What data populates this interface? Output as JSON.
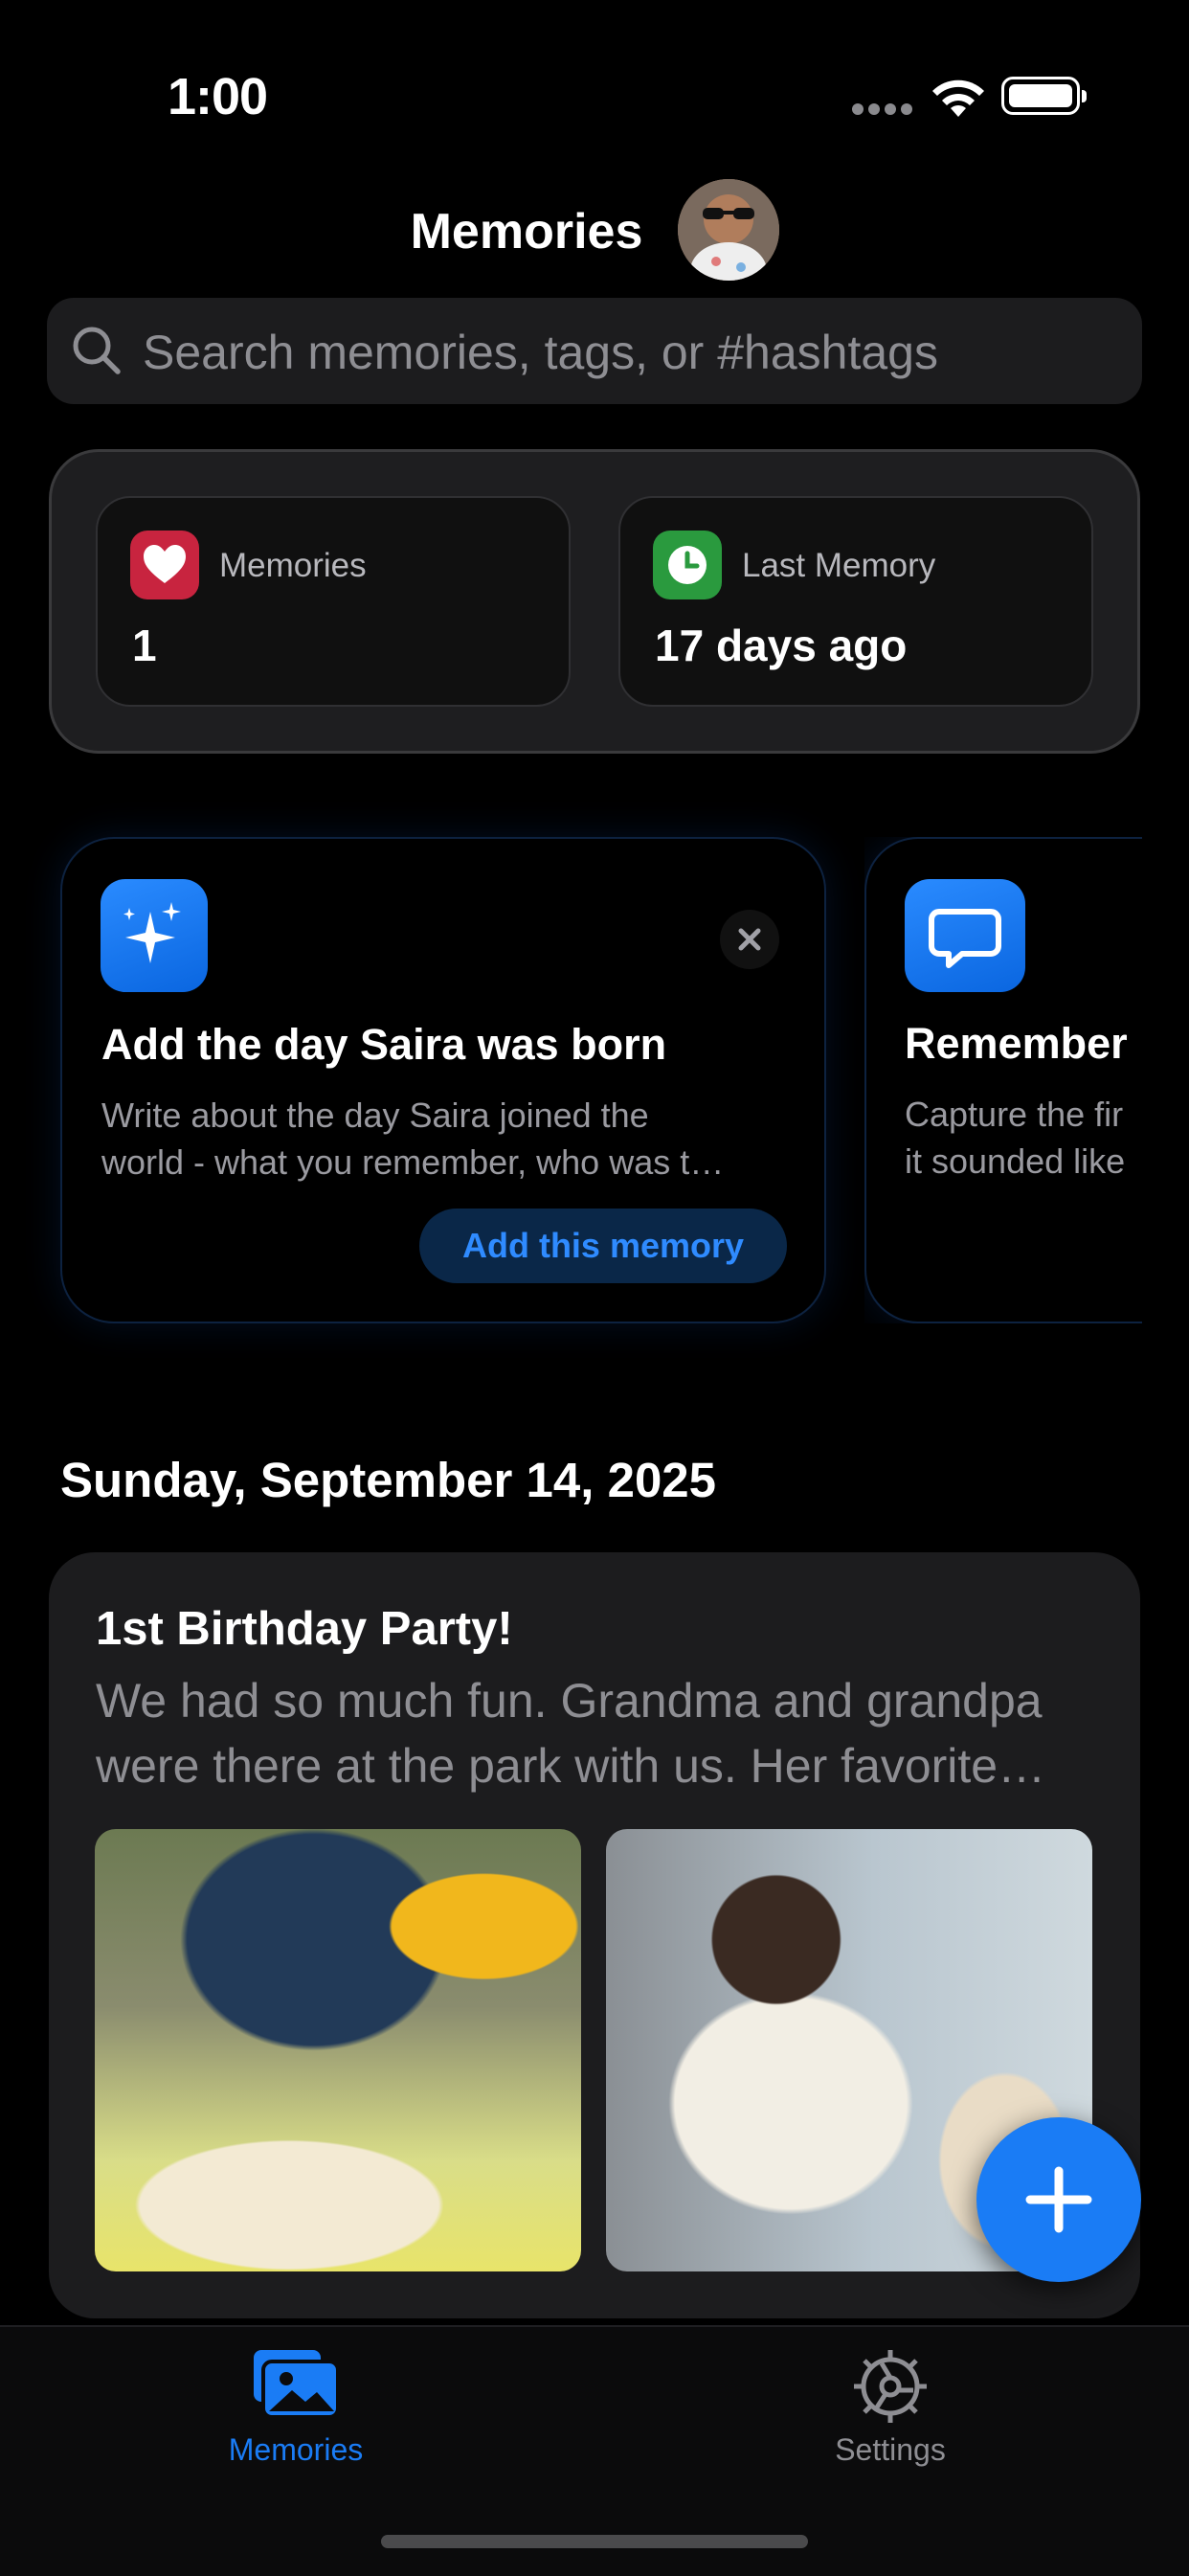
{
  "status_bar": {
    "time": "1:00"
  },
  "header": {
    "title": "Memories"
  },
  "search": {
    "placeholder": "Search memories, tags, or #hashtags"
  },
  "stats": [
    {
      "label": "Memories",
      "value": "1",
      "icon": "heart-icon",
      "color": "#d12e45"
    },
    {
      "label": "Last Memory",
      "value": "17 days ago",
      "icon": "clock-icon",
      "color": "#2ea043"
    }
  ],
  "prompts": [
    {
      "icon": "sparkles-icon",
      "title": "Add the day Saira was born",
      "description_lines": [
        "Write about the day Saira joined the",
        "world - what you remember, who was t…"
      ],
      "action_label": "Add this memory"
    },
    {
      "icon": "speech-bubble-icon",
      "title": "Remember",
      "description_lines": [
        "Capture the fir",
        "it sounded like"
      ]
    }
  ],
  "timeline": {
    "date": "Sunday, September 14, 2025",
    "memory": {
      "title": "1st Birthday Party!",
      "body_lines": [
        "We had so much fun. Grandma and grandpa",
        "were there at the park with us. Her favorite…"
      ],
      "photos": [
        "birthday-cake-photo",
        "baby-highchair-photo"
      ]
    }
  },
  "tabs": [
    {
      "label": "Memories",
      "icon": "photos-icon",
      "active": true
    },
    {
      "label": "Settings",
      "icon": "gear-icon",
      "active": false
    }
  ],
  "colors": {
    "accent": "#1a7cf5",
    "background": "#000000",
    "card": "#1c1c1e"
  }
}
